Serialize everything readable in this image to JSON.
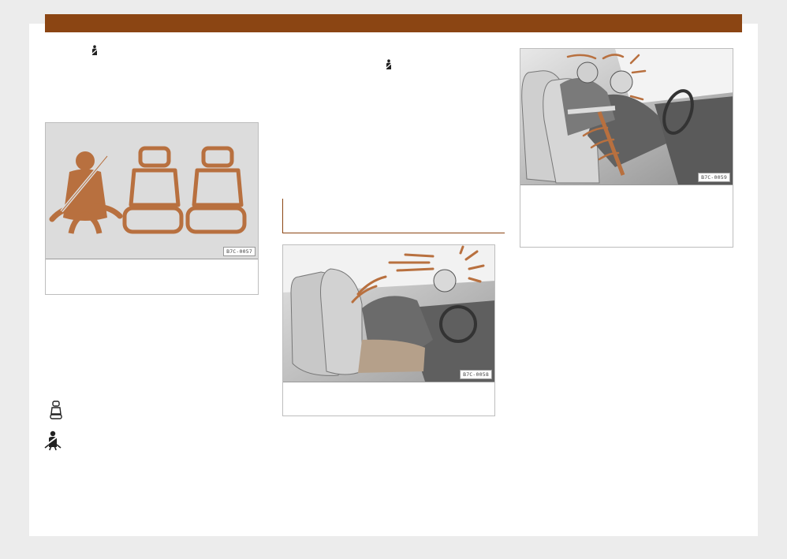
{
  "colors": {
    "accent": "#8b4513",
    "icon_fill": "#b8703f",
    "panel_grey": "#dcdcdc"
  },
  "icons": {
    "inline_belt_left": "seatbelt-icon",
    "inline_belt_mid": "seatbelt-icon",
    "legend_seat": "empty-seat-icon",
    "legend_belt": "seatbelt-warning-icon"
  },
  "figures": {
    "seat_status": {
      "code": "B7C-0057"
    },
    "crash_no_belt": {
      "code": "B7C-0058"
    },
    "rear_impact": {
      "code": "B7C-0059"
    }
  }
}
